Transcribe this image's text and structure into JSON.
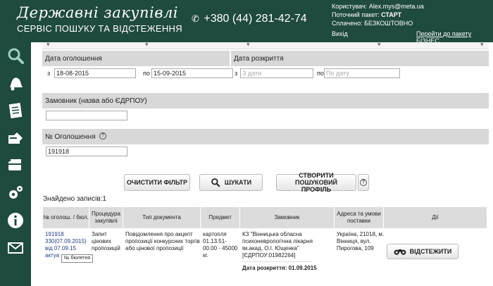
{
  "header": {
    "title": "Державні закупівлі",
    "subtitle": "СЕРВІС ПОШУКУ ТА ВІДСТЕЖЕННЯ",
    "phone": "+380 (44) 281-42-74",
    "user_label": "Користувач:",
    "user_email": "Alex.mys@meta.ua",
    "package_label": "Поточний пакет:",
    "package_value": "СТАРТ",
    "paid_label": "Сплачено:",
    "paid_value": "БЕЗКОШТОВНО",
    "exit": "Вихід",
    "upgrade_link": "Перейти до пакету БІЗНЕС"
  },
  "sidebar": {
    "icons": [
      "search-icon",
      "bell-icon",
      "document-list-icon",
      "edit-cards-icon",
      "wallet-icon",
      "gears-icon",
      "info-icon",
      "mail-icon"
    ]
  },
  "filters": {
    "announce_date_label": "Дата оголошення",
    "opening_date_label": "Дата розкриття",
    "from_label": "з",
    "to_label": "по",
    "announce_from": "18-08-2015",
    "announce_to": "15-09-2015",
    "opening_from_placeholder": "З дати",
    "opening_to_placeholder": "По дату",
    "customer_label": "Замовник (назва або ЄДРПОУ)",
    "customer_value": "",
    "announce_no_label": "№ Оголошення",
    "announce_no_value": "191918",
    "help_icon": "?"
  },
  "buttons": {
    "clear": "ОЧИСТИТИ ФІЛЬТР",
    "search": "ШУКАТИ",
    "create_profile": "СТВОРИТИ ПОШУКОВИЙ ПРОФІЛЬ",
    "help": "?"
  },
  "results": {
    "found_label": "Знайдено записів:1",
    "columns": [
      "№ оголош. / бюл.",
      "Процедура закупівлі",
      "Тип документа",
      "Предмет",
      "Замовник",
      "Адреса та умови поставки",
      "Дії"
    ],
    "rows": [
      {
        "number_line1": "191918",
        "number_line2": "330(07.09.2015)",
        "number_line3": "від 07.09.15",
        "number_line4": "актуа",
        "procedure": "Запит цінових пропозицій",
        "doc_type": "Повідомлення про акцепт пропозиції конкурсних торгів або цінової пропозиції",
        "subject": "картопля 01.13.51-00.00 - 45000 кг.",
        "customer": "КЗ \"Вінницька обласна психоневрологічна лікарня ім.акад. О.І. Ющенка\" [ЄДРПОУ:01982264]",
        "opening_date": "Дата розкриття: 01.09.2015",
        "address": "Україна, 21018, м. Вінниця, вул. Пирогова, 109",
        "action": "ВІДСТЕЖИТИ"
      }
    ],
    "tooltip": "№ бюлетня"
  },
  "colors": {
    "brand": "#1f4a3e",
    "section_bar": "#d8d8d8"
  }
}
